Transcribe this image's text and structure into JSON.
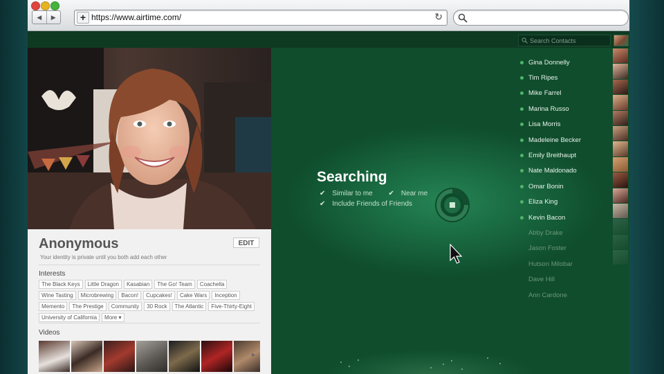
{
  "browser": {
    "url": "https://www.airtime.com/",
    "nav_back": "◀",
    "nav_forward": "▶",
    "new_tab": "+",
    "reload": "↻"
  },
  "contacts_search": {
    "placeholder": "Search Contacts"
  },
  "searching": {
    "title": "Searching",
    "opt_similar": "Similar to me",
    "opt_near": "Near me",
    "opt_friends": "Include Friends of Friends"
  },
  "contacts": [
    {
      "name": "Gina Donnelly",
      "online": true
    },
    {
      "name": "Tim Ripes",
      "online": true
    },
    {
      "name": "Mike Farrel",
      "online": true
    },
    {
      "name": "Marina Russo",
      "online": true
    },
    {
      "name": "Lisa Morris",
      "online": true
    },
    {
      "name": "Madeleine Becker",
      "online": true
    },
    {
      "name": "Emily Breithaupt",
      "online": true
    },
    {
      "name": "Nate Maldonado",
      "online": true
    },
    {
      "name": "Omar Bonin",
      "online": true
    },
    {
      "name": "Eliza King",
      "online": true
    },
    {
      "name": "Kevin Bacon",
      "online": true
    },
    {
      "name": "Abby Drake",
      "online": false
    },
    {
      "name": "Jason Foster",
      "online": false
    },
    {
      "name": "Hutson Milobar",
      "online": false
    },
    {
      "name": "Dave Hill",
      "online": false
    },
    {
      "name": "Ann Cardone",
      "online": false
    }
  ],
  "profile": {
    "name": "Anonymous",
    "subtitle": "Your identity is private until you both add each other",
    "edit_label": "EDIT",
    "interests_label": "Interests",
    "interests": [
      "The Black Keys",
      "Little Dragon",
      "Kasabian",
      "The Go! Team",
      "Coachella",
      "Wine Tasting",
      "Microbrewing",
      "Bacon!",
      "Cupcakes!",
      "Cake Wars",
      "Inception",
      "Memento",
      "The Prestige",
      "Community",
      "30 Rock",
      "The Atlantic",
      "Five-Thirty-Eight",
      "University of California"
    ],
    "more_label": "More ▾",
    "videos_label": "Videos"
  },
  "colors": {
    "accent_green": "#1a6b42",
    "online_dot": "#50b36e"
  }
}
